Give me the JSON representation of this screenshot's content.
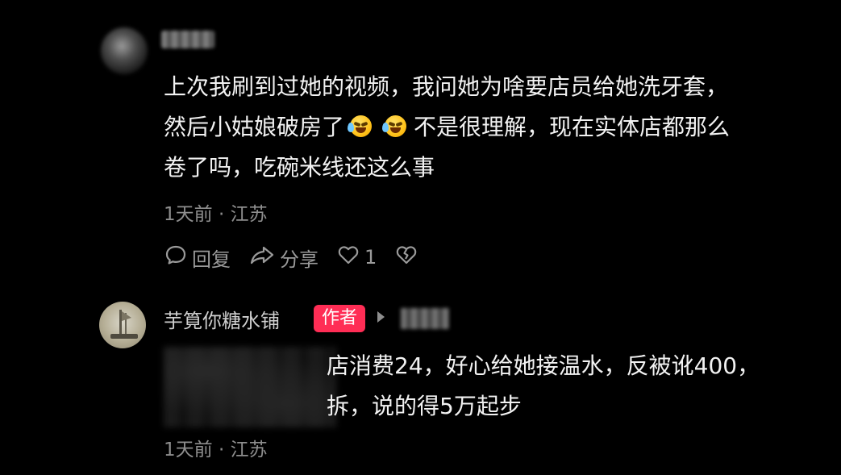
{
  "comments": [
    {
      "lines": [
        "上次我刷到过她的视频，我问她为啥要店员给她洗牙套，",
        "然后小姑娘破房了",
        "不是很理解，现在实体店都那么",
        "卷了吗，吃碗米线还这么事"
      ],
      "meta": "1天前 · 江苏",
      "actions": {
        "reply": "回复",
        "share": "分享",
        "like_count": "1"
      }
    },
    {
      "author": "芋筧你糖水铺",
      "author_badge": "作者",
      "lines": [
        "店消费24，好心给她接温水，反被讹400，",
        "拆，说的得5万起步"
      ],
      "meta": "1天前 · 江苏"
    }
  ],
  "icons": {
    "emoji": "crying-laughing-emoji",
    "reply": "comment-bubble-icon",
    "share": "share-arrow-icon",
    "like": "heart-outline-icon",
    "dislike": "broken-heart-icon",
    "reply_arrow": "triangle-right-icon"
  },
  "colors": {
    "background": "#000000",
    "text": "#f2f2f2",
    "meta": "#8e8e8e",
    "badge": "#ff2d55"
  }
}
